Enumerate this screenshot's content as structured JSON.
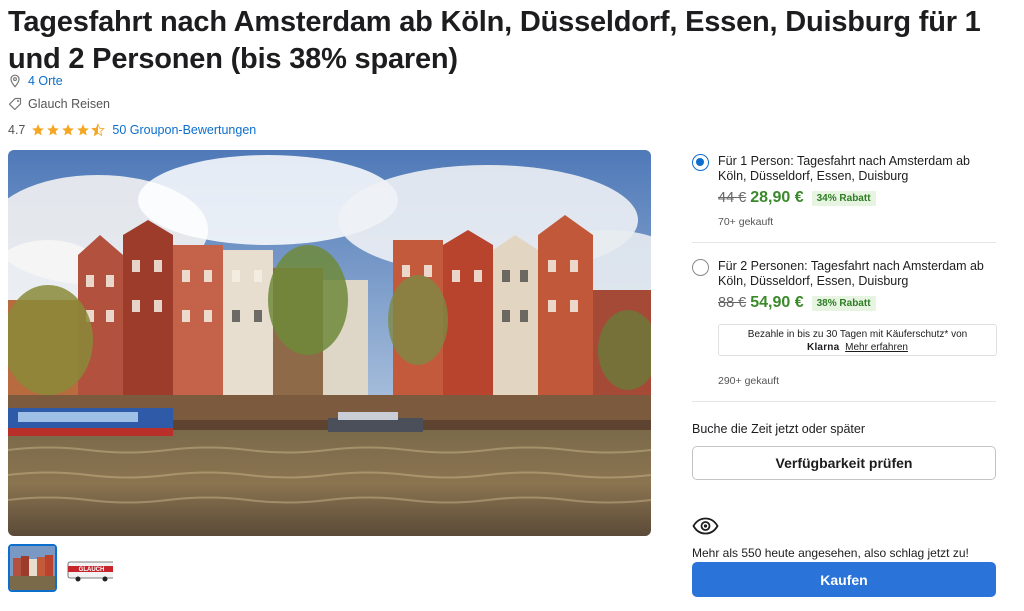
{
  "deal": {
    "title": "Tagesfahrt nach Amsterdam ab Köln, Düsseldorf, Essen, Duisburg für 1 und 2 Personen (bis 38% sparen)",
    "locations_link": "4 Orte",
    "merchant": "Glauch Reisen",
    "rating_value": "4.7",
    "rating_stars": 4.5,
    "reviews_link": "50 Groupon-Bewertungen"
  },
  "gallery": {
    "thumb2_text": "GLAUCH"
  },
  "options": [
    {
      "title": "Für 1 Person: Tagesfahrt nach Amsterdam ab Köln, Düsseldorf, Essen, Duisburg",
      "old_price": "44 €",
      "new_price": "28,90 €",
      "discount": "34% Rabatt",
      "sold": "70+ gekauft",
      "selected": true
    },
    {
      "title": "Für 2 Personen: Tagesfahrt nach Amsterdam ab Köln, Düsseldorf, Essen, Duisburg",
      "old_price": "88 €",
      "new_price": "54,90 €",
      "discount": "38% Rabatt",
      "sold": "290+ gekauft",
      "selected": false
    }
  ],
  "klarna": {
    "text": "Bezahle in bis zu 30 Tagen mit Käuferschutz* von",
    "logo": "Klarna",
    "link": "Mehr erfahren"
  },
  "booking": {
    "label": "Buche die Zeit jetzt oder später",
    "availability_button": "Verfügbarkeit prüfen",
    "views_text": "Mehr als 550 heute angesehen, also schlag jetzt zu!",
    "buy_button": "Kaufen"
  },
  "icons": {
    "location": "map-pin-icon",
    "merchant": "tag-icon",
    "views": "eye-icon"
  },
  "colors": {
    "link": "#0d6ecd",
    "price_green": "#3a8a2b",
    "star": "#f5a623",
    "buy_button": "#2a73d9"
  }
}
